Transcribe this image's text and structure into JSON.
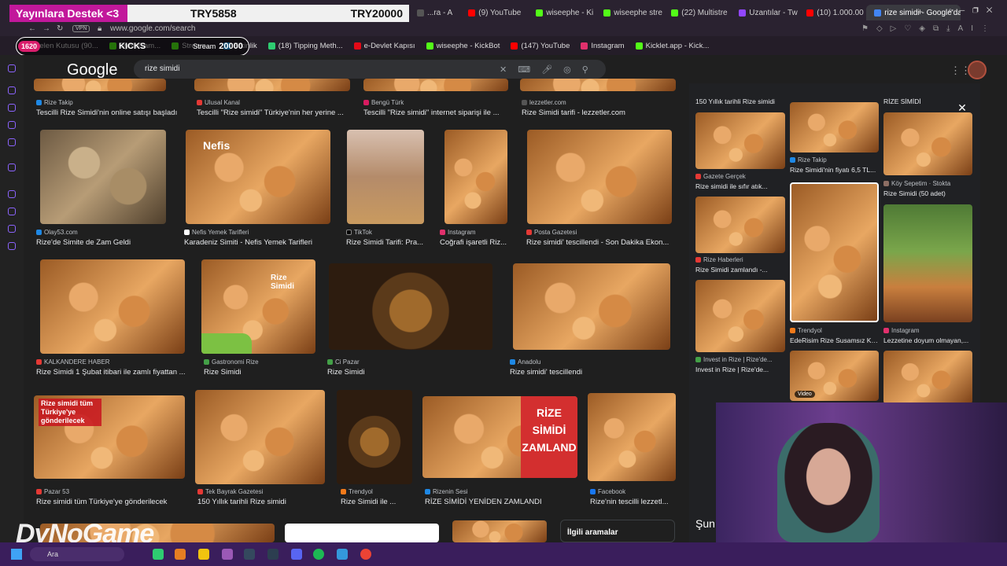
{
  "donation": {
    "label": "Yayınlara Destek <3",
    "current": "TRY5858",
    "goal": "TRY20000"
  },
  "tabs": [
    {
      "label": "...ra - A",
      "color": "#555"
    },
    {
      "label": "(9) YouTube",
      "color": "#ff0000"
    },
    {
      "label": "wiseephe - Ki",
      "color": "#53fc18"
    },
    {
      "label": "wiseephe stre",
      "color": "#53fc18"
    },
    {
      "label": "(22) Multistre",
      "color": "#53fc18"
    },
    {
      "label": "Uzantılar - Tw",
      "color": "#9146ff"
    },
    {
      "label": "(10) 1.000.00",
      "color": "#ff0000"
    },
    {
      "label": "rize simidi - Google'da A",
      "color": "#4285f4",
      "active": true
    }
  ],
  "address": {
    "vpn": "VPN",
    "url": "www.google.com/search"
  },
  "overlay_pill": {
    "count": "1620",
    "text1": "KICKS",
    "text2": "Stream",
    "amount": "20000"
  },
  "bookmarks": [
    {
      "label": "Gelen Kutusu (90...",
      "color": "#ea4335"
    },
    {
      "label": "DyNoGam...",
      "color": "#53fc18"
    },
    {
      "label": "Stream...",
      "color": "#53fc18"
    },
    {
      "label": "Etkinlik",
      "color": "#1da1f2"
    },
    {
      "label": "(18) Tipping Meth...",
      "color": "#2ecc71"
    },
    {
      "label": "e-Devlet Kapısı",
      "color": "#e30a17"
    },
    {
      "label": "wiseephe - KickBot",
      "color": "#53fc18"
    },
    {
      "label": "(147) YouTube",
      "color": "#ff0000"
    },
    {
      "label": "Instagram",
      "color": "#e1306c"
    },
    {
      "label": "Kicklet.app - Kick...",
      "color": "#53fc18"
    }
  ],
  "google": {
    "logo": "Google",
    "query": "rize simidi"
  },
  "row0": [
    {
      "source": "Rize Takip",
      "title": "Tescilli Rize Simidi'nin online satışı başladı",
      "color": "#1e88e5"
    },
    {
      "source": "Ulusal Kanal",
      "title": "Tescilli \"Rize simidi\" Türkiye'nin her yerine ...",
      "color": "#e53935"
    },
    {
      "source": "Bengü Türk",
      "title": "Tescilli \"Rize simidi\" internet siparişi ile ...",
      "color": "#d81b60"
    },
    {
      "source": "lezzetler.com",
      "title": "Rize Simidi tarifi - lezzetler.com",
      "color": "#555"
    }
  ],
  "row1": [
    {
      "source": "Olay53.com",
      "title": "Rize'de Simite de Zam Geldi",
      "color": "#1e88e5",
      "overlay": ""
    },
    {
      "source": "Nefis Yemek Tarifleri",
      "title": "Karadeniz Simiti - Nefis Yemek Tarifleri",
      "color": "#fff",
      "overlay": "Nefis"
    },
    {
      "source": "TikTok",
      "title": "Rize Simidi Tarifi: Pra...",
      "color": "#000",
      "overlay": ""
    },
    {
      "source": "Instagram",
      "title": "Coğrafi işaretli Riz...",
      "color": "#e1306c",
      "overlay": ""
    },
    {
      "source": "Posta Gazetesi",
      "title": "Rize simidi' tescillendi - Son Dakika Ekon...",
      "color": "#e53935",
      "overlay": ""
    }
  ],
  "row2": [
    {
      "source": "KALKANDERE HABER",
      "title": "Rize Simidi 1 Şubat itibari ile zamlı fiyattan ...",
      "color": "#e53935",
      "overlay": ""
    },
    {
      "source": "Gastronomi Rize",
      "title": "Rize Simidi",
      "color": "#43a047",
      "overlay": "Rize Simidi"
    },
    {
      "source": "Ci Pazar",
      "title": "Rize Simidi",
      "color": "#43a047",
      "overlay": ""
    },
    {
      "source": "Anadolu",
      "title": "Rize simidi' tescillendi",
      "color": "#1e88e5",
      "overlay": ""
    }
  ],
  "row3": [
    {
      "source": "Pazar 53",
      "title": "Rize simidi tüm Türkiye'ye gönderilecek",
      "color": "#e53935",
      "overlay": "Rize simidi tüm Türkiye'ye gönderilecek"
    },
    {
      "source": "Tek Bayrak Gazetesi",
      "title": "150 Yıllık tarihli Rize simidi",
      "color": "#e53935",
      "overlay": ""
    },
    {
      "source": "Trendyol",
      "title": "Rize Simidi ile ...",
      "color": "#f27a1a",
      "overlay": ""
    },
    {
      "source": "Rizenin Sesi",
      "title": "RİZE SİMİDİ YENİDEN ZAMLANDI",
      "color": "#1e88e5",
      "overlay": "RİZE SİMİDİ ZAMLAND"
    },
    {
      "source": "Facebook",
      "title": "Rize'nin tescilli lezzetl...",
      "color": "#1877f2",
      "overlay": ""
    }
  ],
  "related": "İlgili aramalar",
  "right_panel": {
    "items": [
      {
        "source": "",
        "title": "150 Yıllık tarihli Rize simidi",
        "color": "#e53935"
      },
      {
        "source": "",
        "title": "RİZE SİMİDİ",
        "color": "#555"
      },
      {
        "source": "Rize Takip",
        "title": "Rize Simidi'nin fiyatı 6,5 TL...",
        "color": "#1e88e5"
      },
      {
        "source": "Gazete Gerçek",
        "title": "Rize simidi ile sıfır atık...",
        "color": "#e53935"
      },
      {
        "source": "Köy Sepetim · Stokta",
        "title": "Rize Simidi (50 adet)",
        "color": "#8d6e63"
      },
      {
        "source": "Rize Haberleri",
        "title": "Rize Simidi zamlandı -...",
        "color": "#e53935"
      },
      {
        "source": "Trendyol",
        "title": "EdeRisim Rize Susamsız Kel...",
        "color": "#f27a1a"
      },
      {
        "source": "Instagram",
        "title": "Lezzetine doyum olmayan,...",
        "color": "#e1306c"
      },
      {
        "source": "Invest in Rize | Rize'de...",
        "title": "Invest in Rize | Rize'de...",
        "color": "#43a047"
      }
    ],
    "video_label": "Video"
  },
  "partial_text": "Şun",
  "streamer_logo": "DyNoGame",
  "taskbar": {
    "search_label": "Ara"
  }
}
